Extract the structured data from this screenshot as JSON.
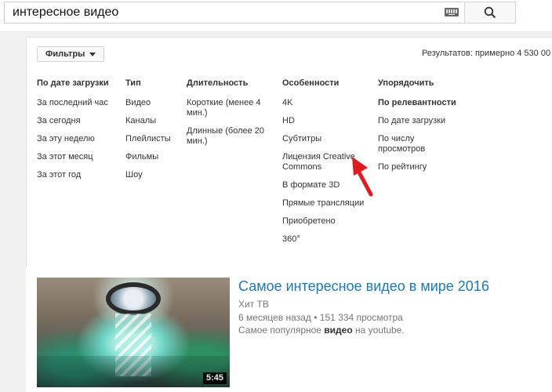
{
  "search": {
    "query": "интересное видео"
  },
  "filters": {
    "button_label": "Фильтры",
    "results_text": "Результатов: примерно 4 530 00"
  },
  "columns": [
    {
      "header": "По дате загрузки",
      "items": [
        "За последний час",
        "За сегодня",
        "За эту неделю",
        "За этот месяц",
        "За этот год"
      ]
    },
    {
      "header": "Тип",
      "items": [
        "Видео",
        "Каналы",
        "Плейлисты",
        "Фильмы",
        "Шоу"
      ]
    },
    {
      "header": "Длительность",
      "items": [
        "Короткие (менее 4 мин.)",
        "Длинные (более 20 мин.)"
      ]
    },
    {
      "header": "Особенности",
      "items": [
        "4K",
        "HD",
        "Субтитры",
        "Лицензия Creative Commons",
        "В формате 3D",
        "Прямые трансляции",
        "Приобретено",
        "360°"
      ]
    },
    {
      "header": "Упорядочить",
      "items": [
        "По релевантности",
        "По дате загрузки",
        "По числу просмотров",
        "По рейтингу"
      ]
    }
  ],
  "video": {
    "title": "Самое интересное видео в мире 2016",
    "channel": "Хит ТВ",
    "age": "6 месяцев назад",
    "separator": "•",
    "views": "151 334 просмотра",
    "desc_before": "Самое популярное ",
    "desc_bold": "видео",
    "desc_after": " на youtube.",
    "duration": "5:45"
  },
  "colors": {
    "link": "#167ac6",
    "annotation_arrow": "#e3191b"
  },
  "icons": {
    "search": "search-icon",
    "keyboard": "keyboard-icon",
    "filter_caret": "caret-down-icon",
    "annotation": "red-arrow-icon"
  }
}
